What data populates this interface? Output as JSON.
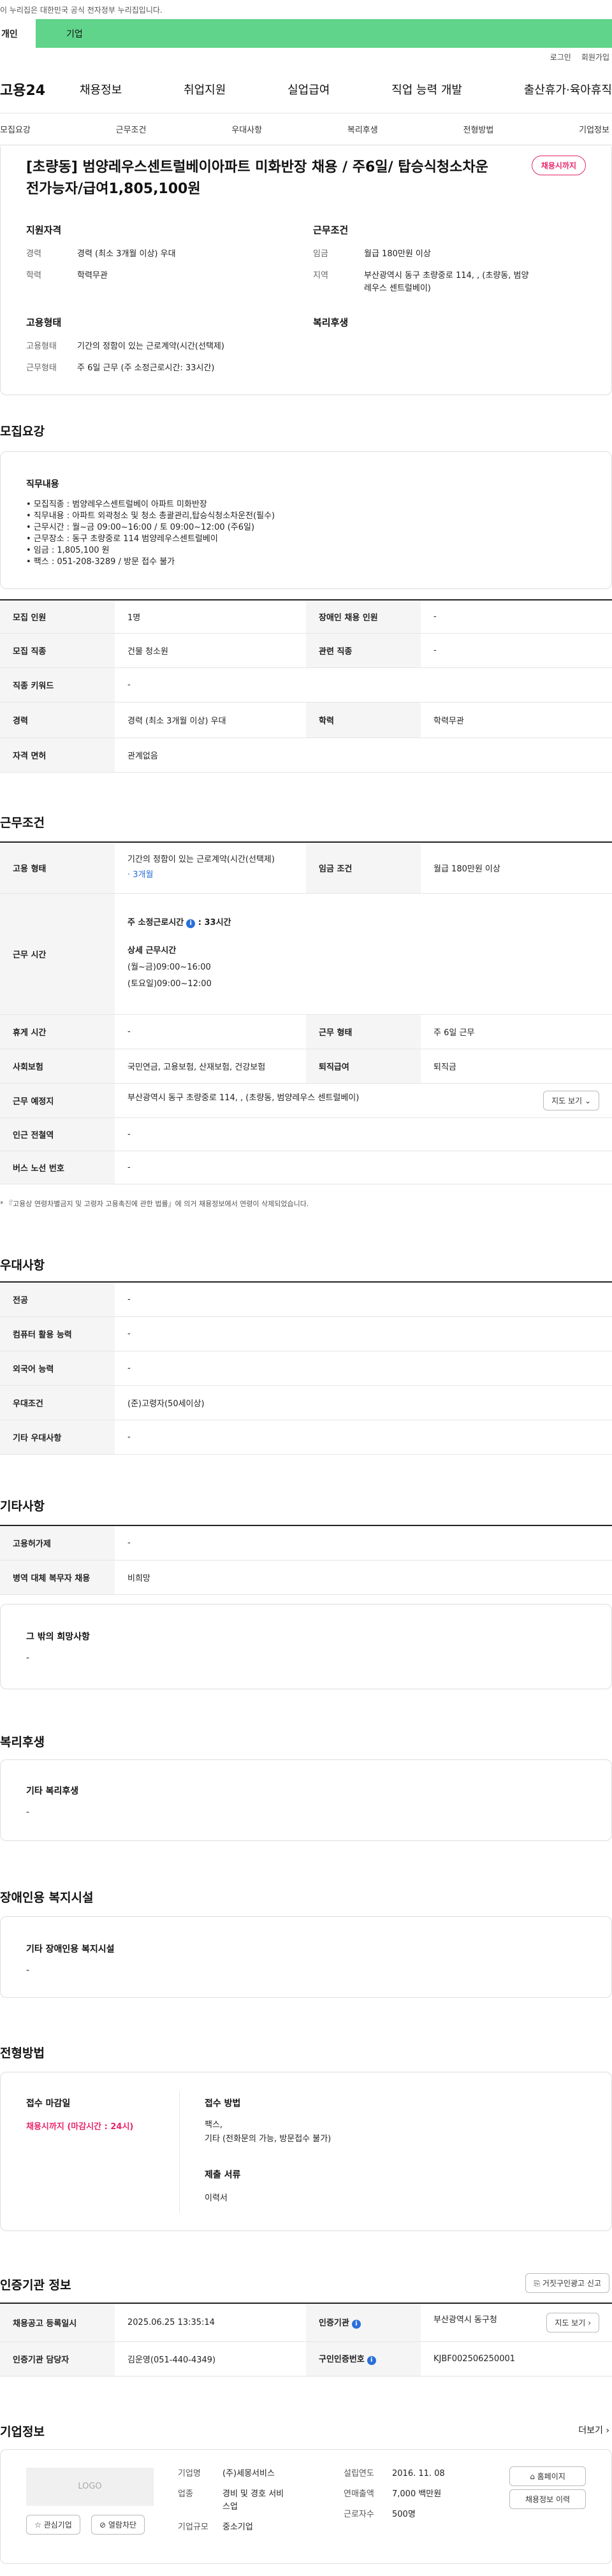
{
  "gov_notice": "이 누리집은 대한민국 공식 전자정부 누리집입니다.",
  "tabs": {
    "personal": "개인",
    "company": "기업"
  },
  "util": {
    "login": "로그인",
    "join": "회원가입"
  },
  "logo": "고용24",
  "gnb": [
    "채용정보",
    "취업지원",
    "실업급여",
    "직업 능력 개발",
    "출산휴가·육아휴직"
  ],
  "snb": [
    "모집요강",
    "근무조건",
    "우대사항",
    "복리후생",
    "전형방법",
    "기업정보"
  ],
  "headline": {
    "title": "[초량동] 범양레우스센트럴베이아파트 미화반장 채용 / 주6일/ 탑승식청소차운전가능자/급여1,805,100원",
    "status": "채용시까지",
    "qual_head": "지원자격",
    "qual": [
      {
        "k": "경력",
        "v": "경력 (최소 3개월 이상) 우대"
      },
      {
        "k": "학력",
        "v": "학력무관"
      }
    ],
    "emp_head": "고용형태",
    "emp": [
      {
        "k": "고용형태",
        "v": "기간의 정함이 있는 근로계약(시간(선택제)"
      },
      {
        "k": "근무형태",
        "v": "주 6일 근무 (주 소정근로시간: 33시간)"
      }
    ],
    "cond_head": "근무조건",
    "cond": [
      {
        "k": "임금",
        "v": "월급 180만원 이상"
      },
      {
        "k": "지역",
        "v": "부산광역시 동구 초량중로 114, , (초량동, 범양레우스 센트럴베이)"
      }
    ],
    "welfare_head": "복리후생"
  },
  "recruit": {
    "title": "모집요강",
    "duty_label": "직무내용",
    "duty_lines": [
      "• 모집직종 : 범양레우스센트럴베이 아파트 미화반장",
      "• 직무내용 : 아파트 외곽청소 및 청소 총괄관리,탑승식청소차운전(필수)",
      "• 근무시간 : 월~금 09:00~16:00 / 토 09:00~12:00  (주6일)",
      "• 근무장소 : 동구 초량중로 114 범양레우스센트럴베이",
      "• 임금 : 1,805,100 원",
      "• 팩스 : 051-208-3289 / 방문 접수 불가"
    ],
    "rows": [
      [
        "모집 인원",
        "1명",
        "장애인 채용 인원",
        "-"
      ],
      [
        "모집 직종",
        "건물 청소원",
        "관련 직종",
        "-"
      ],
      [
        "직종 키워드",
        "-",
        "",
        ""
      ],
      [
        "경력",
        "경력 (최소 3개월 이상) 우대",
        "학력",
        "학력무관"
      ],
      [
        "자격 면허",
        "관계없음",
        "",
        ""
      ]
    ]
  },
  "work": {
    "title": "근무조건",
    "emp_type_label": "고용 형태",
    "emp_type_value": "기간의 정함이 있는 근로계약(시간(선택제)",
    "emp_type_sub": "· 3개월",
    "wage_label": "임금 조건",
    "wage_value": "월급 180만원 이상",
    "hours_label": "근무 시간",
    "hours_week": "주 소정근로시간",
    "hours_week_value": ": 33시간",
    "hours_detail_head": "상세 근무시간",
    "hours_detail_1": "(월~금)09:00~16:00",
    "hours_detail_2": "(토요일)09:00~12:00",
    "rows": [
      [
        "휴게 시간",
        "-",
        "근무 형태",
        "주 6일 근무"
      ],
      [
        "사회보험",
        "국민연금, 고용보험, 산재보험, 건강보험",
        "퇴직급여",
        "퇴직금"
      ]
    ],
    "place_label": "근무 예정지",
    "place_value": "부산광역시 동구 초량중로 114, , (초량동, 범양레우스 센트럴베이)",
    "map_btn": "지도 보기",
    "station_label": "인근 전철역",
    "station_value": "-",
    "bus_label": "버스 노선 번호",
    "bus_value": "-",
    "note": "* 『고용상 연령차별금지 및 고령자 고용촉진에 관한 법률』에 의거 채용정보에서 연령이 삭제되었습니다."
  },
  "pref": {
    "title": "우대사항",
    "rows": [
      [
        "전공",
        "-"
      ],
      [
        "컴퓨터 활용 능력",
        "-"
      ],
      [
        "외국어 능력",
        "-"
      ],
      [
        "우대조건",
        "(준)고령자(50세이상)"
      ],
      [
        "기타 우대사항",
        "-"
      ]
    ]
  },
  "etc": {
    "title": "기타사항",
    "rows": [
      [
        "고용허가제",
        "-"
      ],
      [
        "병역 대체 복무자 채용",
        "비희망"
      ]
    ],
    "other_label": "그 밖의 희망사항",
    "other_value": "-"
  },
  "welfare": {
    "title": "복리후생",
    "label": "기타 복리후생",
    "value": "-"
  },
  "disabled": {
    "title": "장애인용 복지시설",
    "label": "기타 장애인용 복지시설",
    "value": "-"
  },
  "selection": {
    "title": "전형방법",
    "deadline_label": "접수 마감일",
    "deadline_value": "채용시까지 (마감시간 : 24시)",
    "method_label": "접수 방법",
    "method_1": "팩스,",
    "method_2": "기타 (전화문의 가능, 방문접수 불가)",
    "docs_label": "제출 서류",
    "docs_value": "이력서"
  },
  "agency": {
    "title": "인증기관 정보",
    "report_btn": "거짓구인광고 신고",
    "reg_label": "채용공고 등록일시",
    "reg_value": "2025.06.25 13:35:14",
    "org_label": "인증기관",
    "org_value": "부산광역시 동구청",
    "map_btn": "지도 보기",
    "staff_label": "인증기관 담당자",
    "staff_value": "김운영(051-440-4349)",
    "id_label": "구인인증번호",
    "id_value": "KJBF002506250001"
  },
  "company": {
    "title": "기업정보",
    "more": "더보기",
    "logo_text": "LOGO",
    "fav_btn": "관심기업",
    "block_btn": "열람차단",
    "name_label": "기업명",
    "name_value": "(주)세몽서비스",
    "biz_label": "업종",
    "biz_value_1": "경비 및 경호 서비",
    "biz_value_2": "스업",
    "scale_label": "기업규모",
    "scale_value": "중소기업",
    "est_label": "설립연도",
    "est_value": "2016. 11. 08",
    "sales_label": "연매출액",
    "sales_value": "7,000 백만원",
    "emp_label": "근로자수",
    "emp_value": "500명",
    "home_btn": "홈페이지",
    "jobs_btn": "채용정보 이력"
  }
}
